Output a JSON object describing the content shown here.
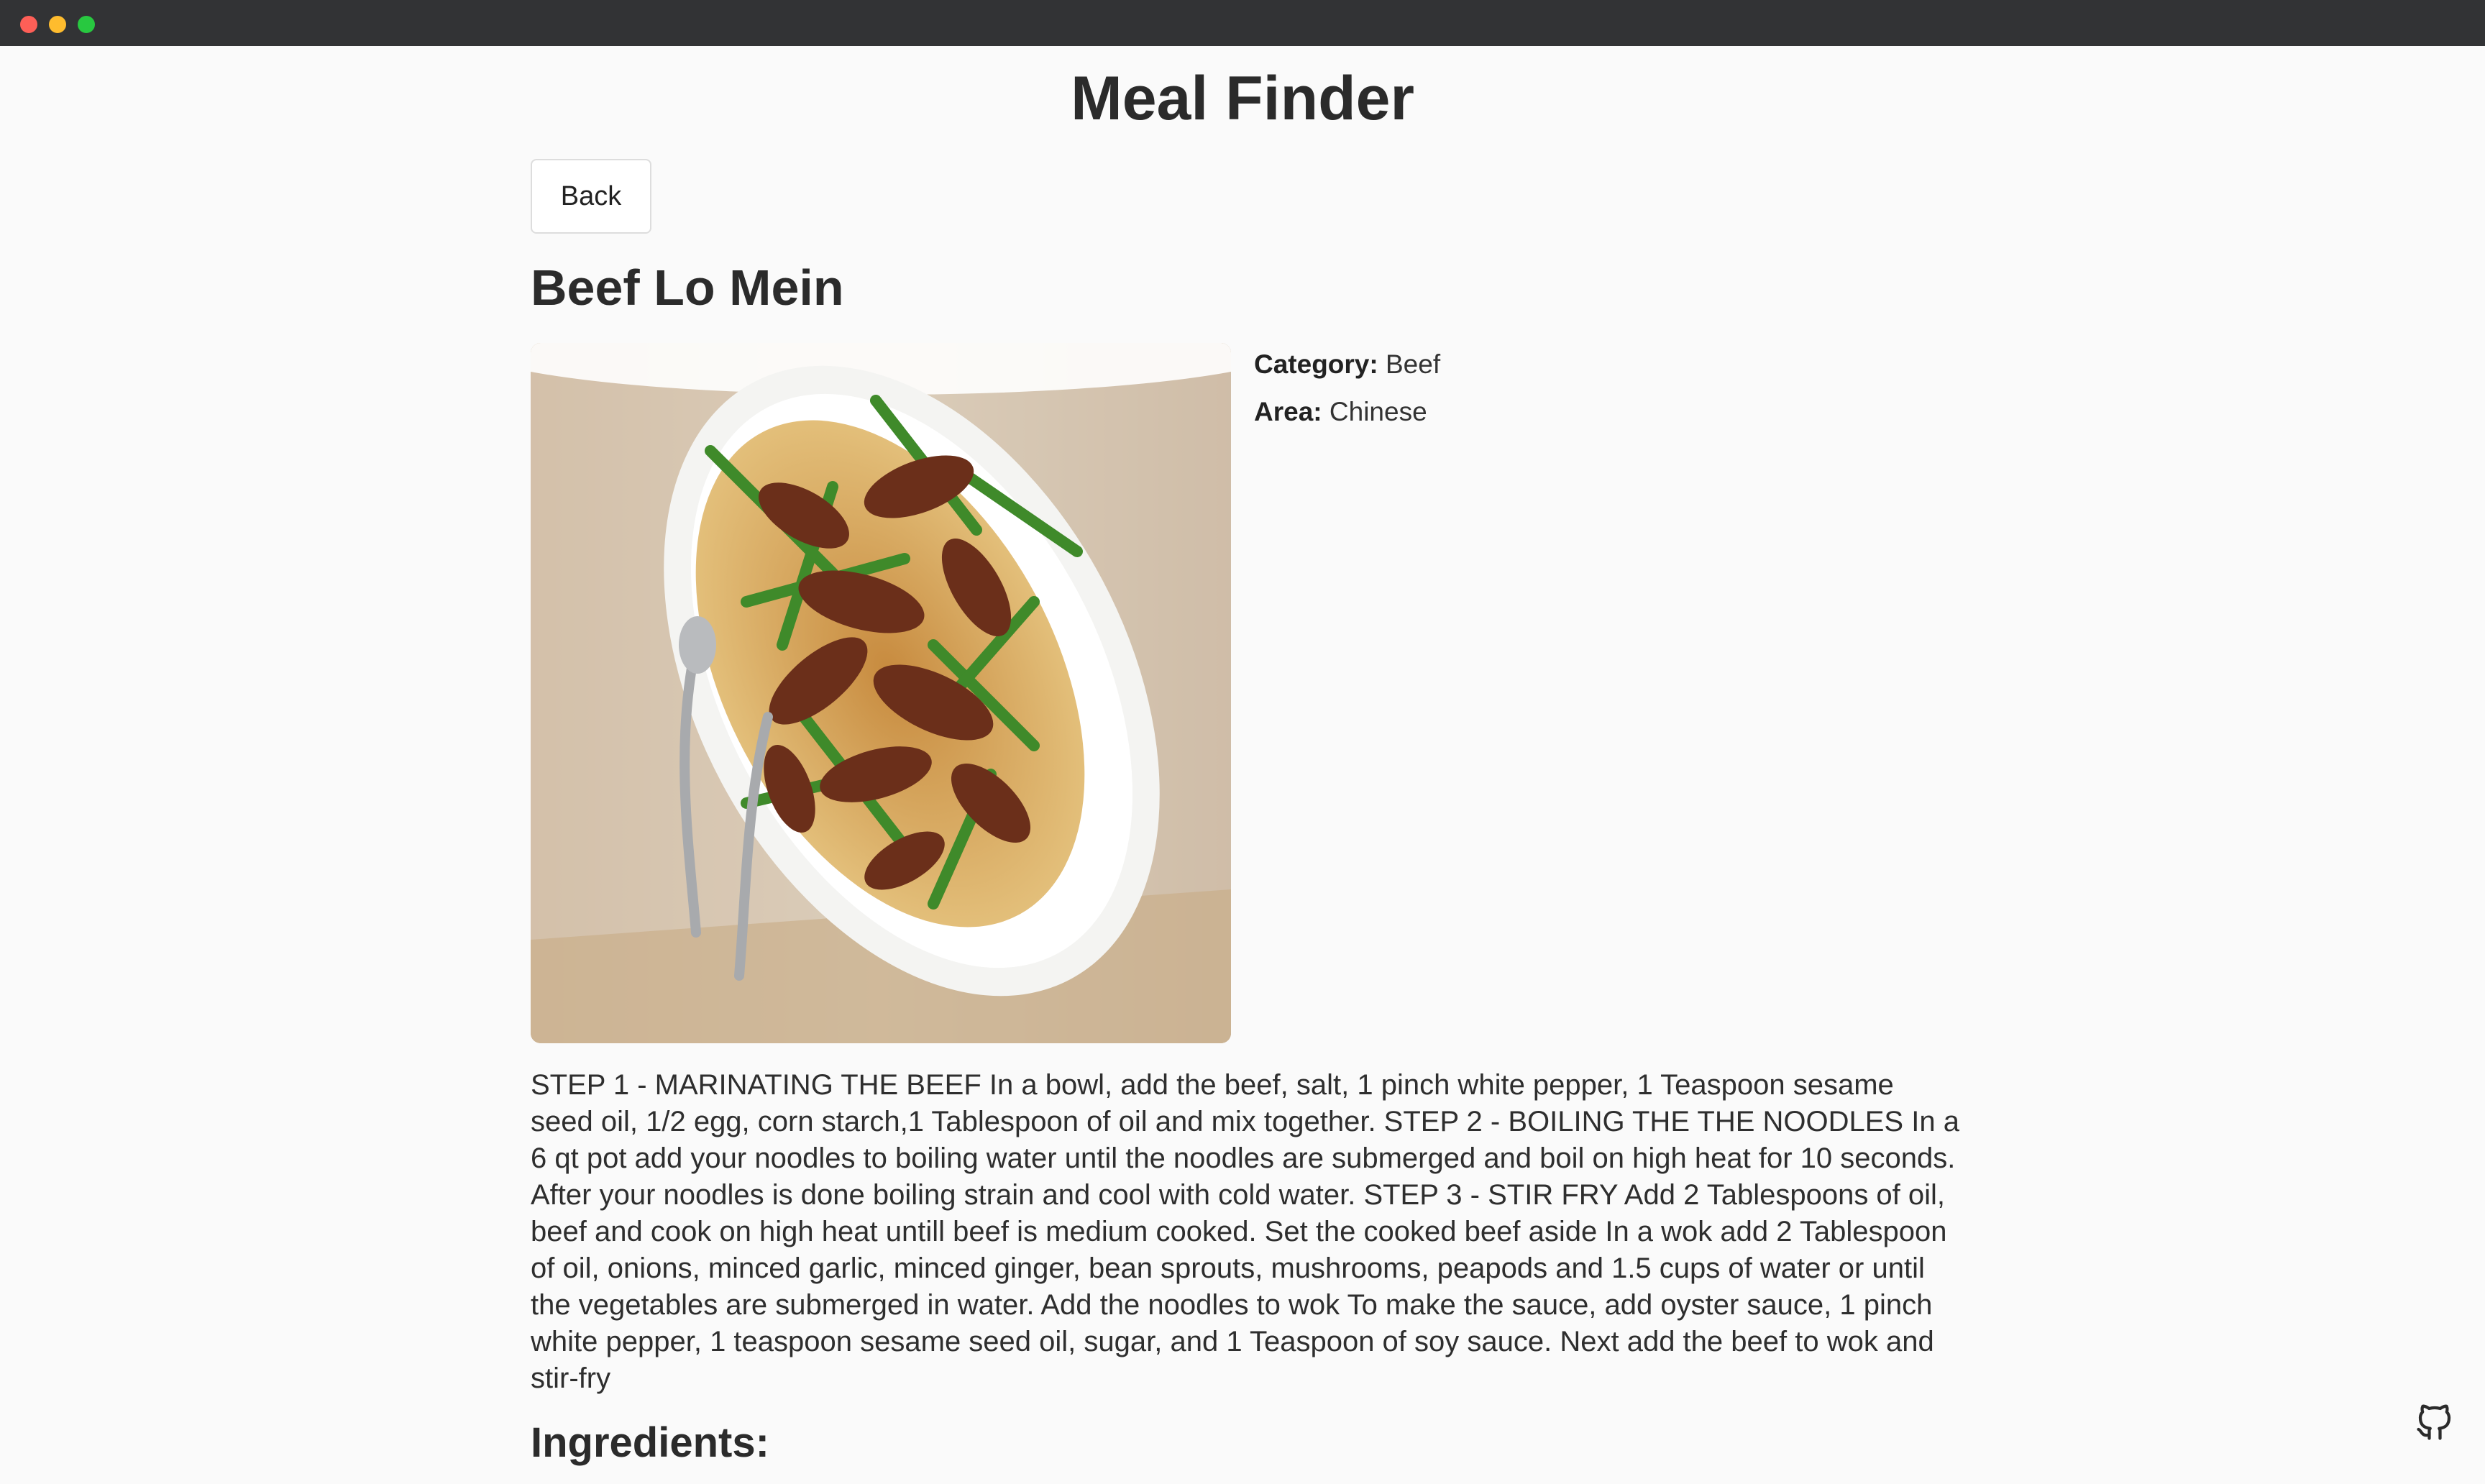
{
  "app": {
    "title": "Meal Finder"
  },
  "nav": {
    "back_label": "Back"
  },
  "meal": {
    "name": "Beef Lo Mein",
    "image_alt": "Beef Lo Mein",
    "category_label": "Category:",
    "category": "Beef",
    "area_label": "Area:",
    "area": "Chinese",
    "instructions": "STEP 1 - MARINATING THE BEEF In a bowl, add the beef, salt, 1 pinch white pepper, 1 Teaspoon sesame seed oil, 1/2 egg, corn starch,1 Tablespoon of oil and mix together. STEP 2 - BOILING THE THE NOODLES In a 6 qt pot add your noodles to boiling water until the noodles are submerged and boil on high heat for 10 seconds. After your noodles is done boiling strain and cool with cold water. STEP 3 - STIR FRY Add 2 Tablespoons of oil, beef and cook on high heat untill beef is medium cooked. Set the cooked beef aside In a wok add 2 Tablespoon of oil, onions, minced garlic, minced ginger, bean sprouts, mushrooms, peapods and 1.5 cups of water or until the vegetables are submerged in water. Add the noodles to wok To make the sauce, add oyster sauce, 1 pinch white pepper, 1 teaspoon sesame seed oil, sugar, and 1 Teaspoon of soy sauce. Next add the beef to wok and stir-fry",
    "ingredients_heading": "Ingredients:"
  },
  "icons": {
    "github": "github-icon"
  },
  "colors": {
    "titlebar": "#323335",
    "background": "#fafafa",
    "text": "#2b2b2b",
    "traffic_close": "#fe5f57",
    "traffic_minimize": "#febc2e",
    "traffic_maximize": "#28c840"
  }
}
